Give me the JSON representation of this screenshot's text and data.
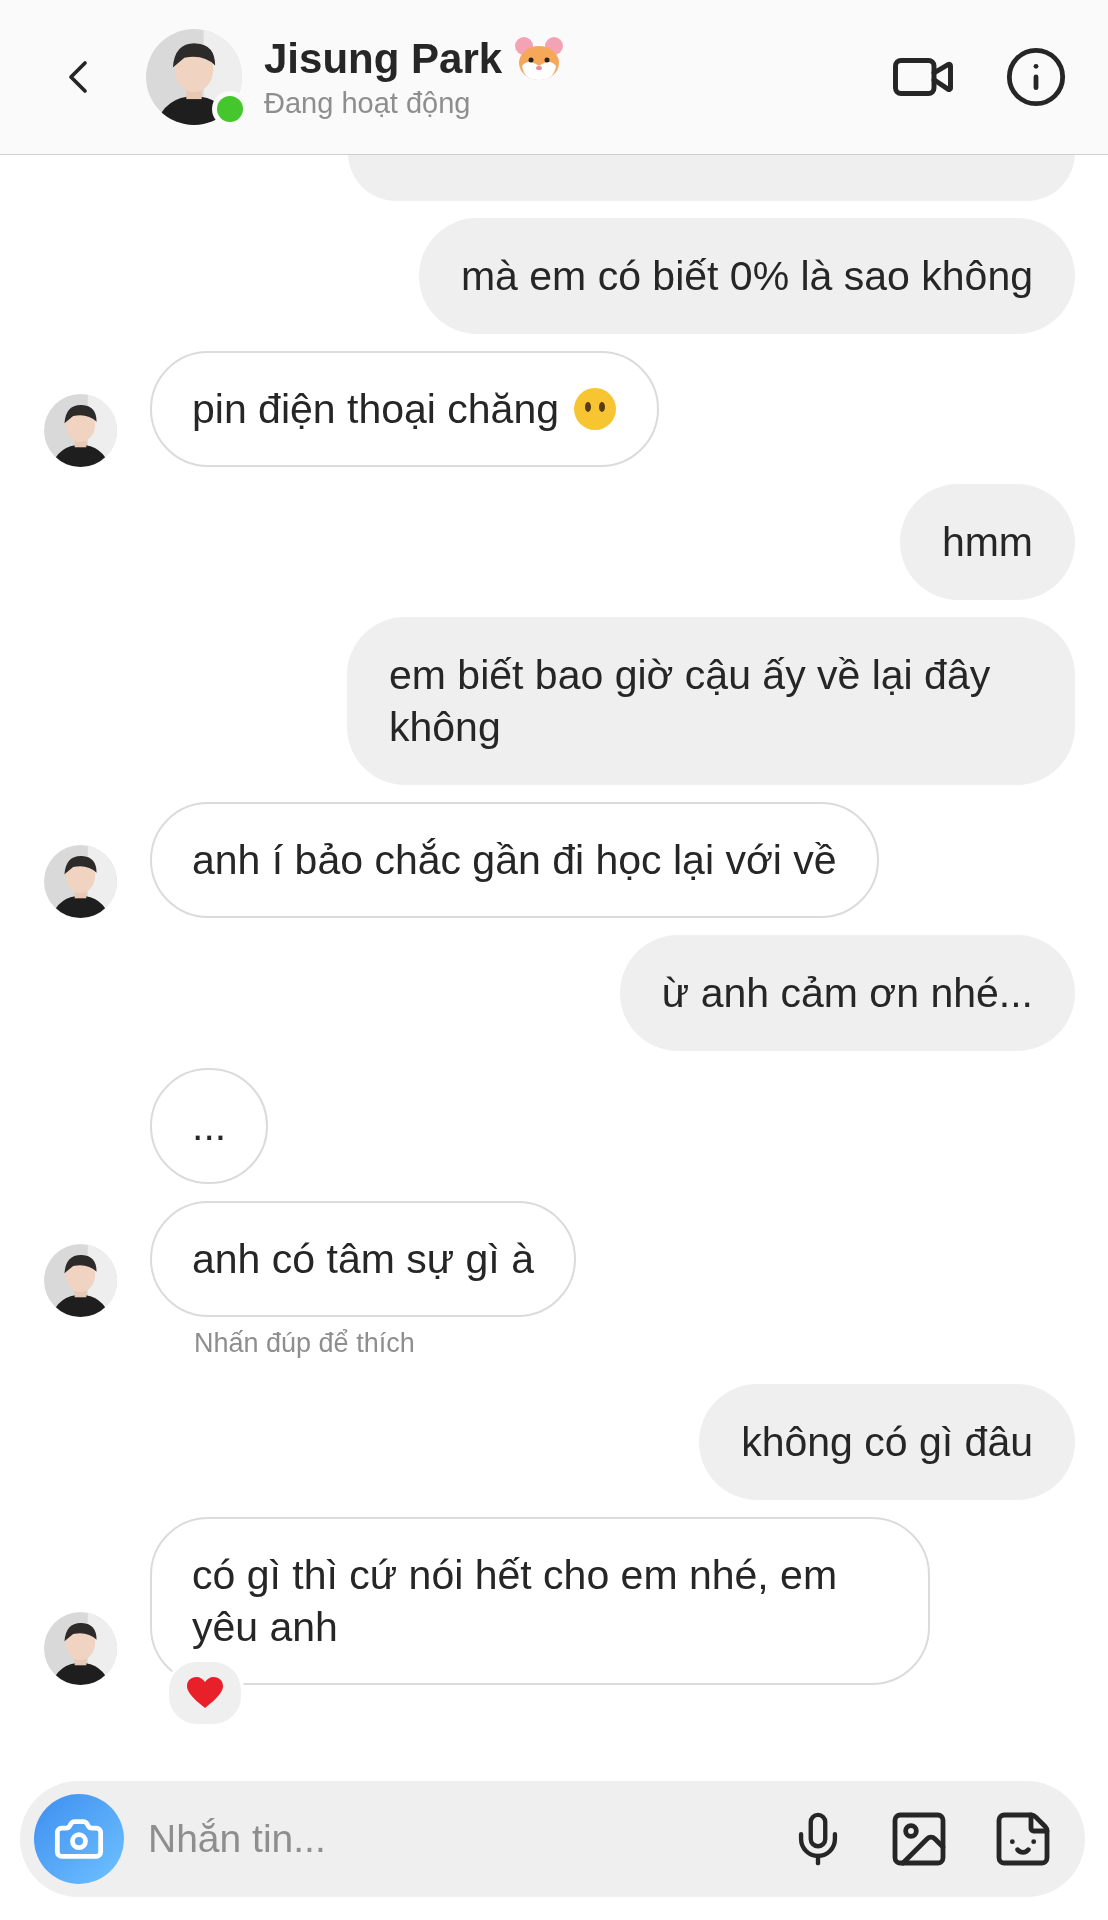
{
  "header": {
    "name": "Jisung Park",
    "status": "Đang hoạt động",
    "online": true
  },
  "messages": [
    {
      "kind": "sent_cut"
    },
    {
      "kind": "sent",
      "text": "mà em có biết 0% là sao không"
    },
    {
      "kind": "received",
      "text": "pin điện thoại chăng",
      "face_emoji": true,
      "avatar": true
    },
    {
      "kind": "sent",
      "text": "hmm"
    },
    {
      "kind": "sent",
      "text": "em biết bao giờ cậu ấy về lại đây không"
    },
    {
      "kind": "received",
      "text": "anh í bảo chắc gần đi học lại với về",
      "avatar": true
    },
    {
      "kind": "sent",
      "text": "ừ anh cảm ơn nhé..."
    },
    {
      "kind": "received",
      "text": "...",
      "avatar": false
    },
    {
      "kind": "received",
      "text": "anh có tâm sự gì à",
      "avatar": true
    },
    {
      "kind": "hint",
      "text": "Nhấn đúp để thích"
    },
    {
      "kind": "sent",
      "text": "không có gì đâu"
    },
    {
      "kind": "received",
      "text": "có gì thì cứ nói hết cho em nhé, em yêu anh",
      "avatar": true,
      "heart_reaction": true
    }
  ],
  "composer": {
    "placeholder": "Nhắn tin..."
  }
}
